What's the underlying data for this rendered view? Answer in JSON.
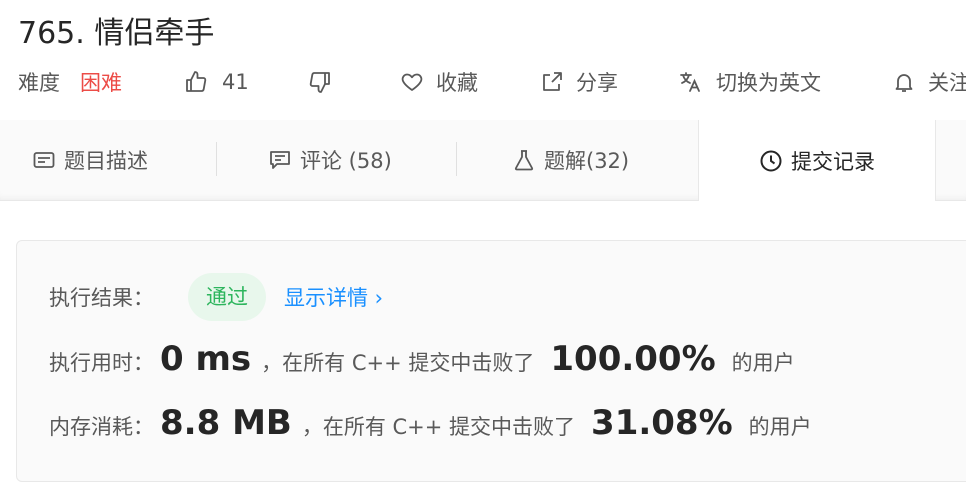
{
  "problem": {
    "title": "765. 情侣牵手"
  },
  "meta": {
    "difficulty_label": "难度",
    "difficulty_value": "困难",
    "likes": "41",
    "favorite_label": "收藏",
    "share_label": "分享",
    "translate_label": "切换为英文",
    "follow_label": "关注"
  },
  "tabs": [
    {
      "label": "题目描述",
      "icon": "description-icon"
    },
    {
      "label": "评论 (58)",
      "icon": "comment-icon"
    },
    {
      "label": "题解(32)",
      "icon": "flask-icon"
    },
    {
      "label": "提交记录",
      "icon": "clock-icon"
    }
  ],
  "result": {
    "label": "执行结果：",
    "status": "通过",
    "details_link": "显示详情 ›",
    "runtime_label": "执行用时：",
    "runtime_value": "0 ms",
    "runtime_text": "，在所有 C++ 提交中击败了",
    "runtime_pct": "100.00%",
    "runtime_tail": "的用户",
    "memory_label": "内存消耗：",
    "memory_value": "8.8 MB",
    "memory_text": "，在所有 C++ 提交中击败了",
    "memory_pct": "31.08%",
    "memory_tail": "的用户"
  },
  "colors": {
    "hard": "#ec4c47",
    "pass_bg": "#e8f7ec",
    "pass_fg": "#2db55d",
    "link": "#1a90ff"
  }
}
